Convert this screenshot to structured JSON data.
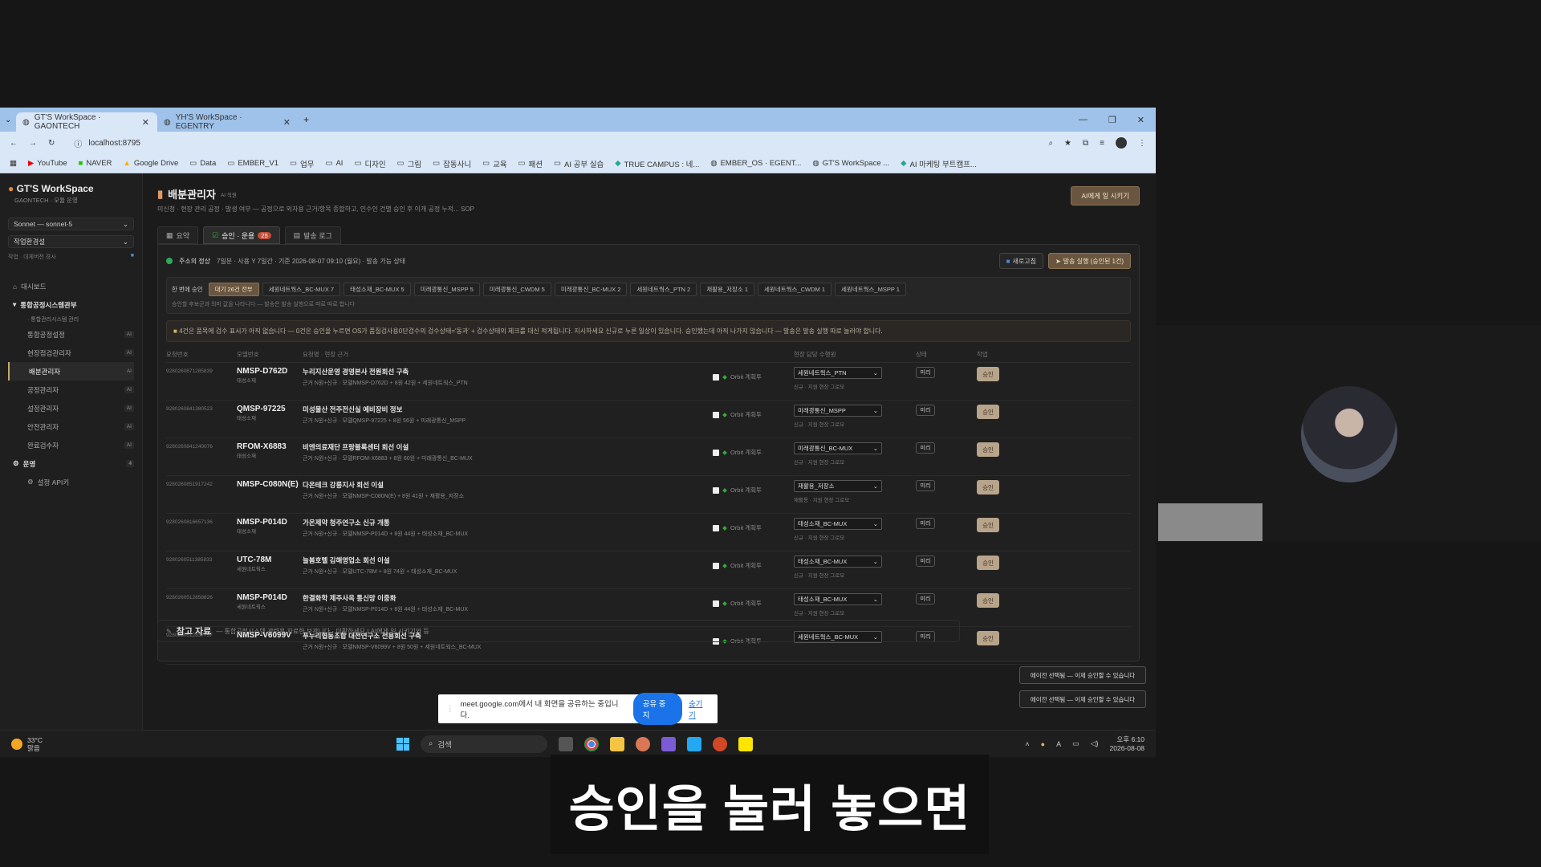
{
  "browser": {
    "tabs": [
      {
        "title": "GT'S WorkSpace · GAONTECH",
        "active": true
      },
      {
        "title": "YH'S WorkSpace · EGENTRY",
        "active": false
      }
    ],
    "url": "localhost:8795",
    "bookmarks": [
      "YouTube",
      "NAVER",
      "Google Drive",
      "Data",
      "EMBER_V1",
      "업무",
      "AI",
      "디자인",
      "그림",
      "잡동사니",
      "교육",
      "패션",
      "AI 공부 실습",
      "TRUE CAMPUS : 네...",
      "EMBER_OS · EGENT...",
      "GT'S WorkSpace ...",
      "AI 마케팅 부트캠프..."
    ]
  },
  "sidebar": {
    "title": "GT'S WorkSpace",
    "subtitle": "GAONTECH · 모듈 운영",
    "model_select": "Sonnet — sonnet-5",
    "profile_select": "작업환경설",
    "note": "작업 · 대체버전 경사",
    "items": [
      {
        "label": "대시보드",
        "badge": "",
        "type": "top"
      },
      {
        "label": "통합공정시스템관부",
        "badge": "",
        "type": "section"
      },
      {
        "label": "· 통합관리시스템 관리",
        "badge": "",
        "type": "sub"
      },
      {
        "label": "통합공정설정",
        "badge": "AI",
        "type": "sub"
      },
      {
        "label": "현장점검관리자",
        "badge": "AI",
        "type": "sub"
      },
      {
        "label": "배분관리자",
        "badge": "AI",
        "type": "sub",
        "active": true
      },
      {
        "label": "공정관리자",
        "badge": "AI",
        "type": "sub"
      },
      {
        "label": "설정관리자",
        "badge": "AI",
        "type": "sub"
      },
      {
        "label": "안전관리자",
        "badge": "AI",
        "type": "sub"
      },
      {
        "label": "완료검수자",
        "badge": "AI",
        "type": "sub"
      },
      {
        "label": "운영",
        "badge": "4",
        "type": "section"
      },
      {
        "label": "설정 API키",
        "badge": "",
        "type": "sub"
      }
    ]
  },
  "page": {
    "title": "배분관리자",
    "title_tag": "AI 직원",
    "desc": "미신청 · 현장 관리 공정 · 발생 여부 — 공정으로 외자용 근거/항목 종합하고, 인수인 건별 승인 후 이개 공정 누적... SOP",
    "top_button": "AI에게 일 시키기",
    "tabs": [
      {
        "label": "요약",
        "count": ""
      },
      {
        "label": "승인 · 운용",
        "count": "25",
        "active": true
      },
      {
        "label": "발송 로그",
        "count": ""
      }
    ]
  },
  "status": {
    "text": "주소의 정상",
    "detail": "7일분 · 사용 Y 7일간 · 기준 2026-08-07 09:10 (월요) · 발송 가능 상태",
    "refresh": "새로고침",
    "run_button": "발송 실행 (승인된 1건)"
  },
  "filters": {
    "label": "한 번에 승인",
    "chips": [
      "대기 26건 전부",
      "세원네트웍스_BC-MUX 7",
      "태성소재_BC-MUX 5",
      "미래광통신_MSPP 5",
      "미래광통신_CWDM 5",
      "미래광통신_BC-MUX 2",
      "세원네트웍스_PTN 2",
      "재활용_저장소 1",
      "세원네트웍스_CWDM 1",
      "세원네트웍스_MSPP 1"
    ],
    "note": "승인할 후보군과 의미 값을 나타니다 — 발송은 발송 실행으로 따로 따로 합니다"
  },
  "notice": "4건은 품목에 검수 표시가 아직 없습니다 — 0건은 승인을 누르면 OS가 품질검사용0단검수의 검수상태='동과' + 검수상태의 체크를 대신 적게됩니다. 지시하세요 신규로 누른 일상이 있습니다. 승인했는데 아직 나가지 않습니다 — 발송은 발송 실행 따로 눌러야 합니다.",
  "table": {
    "headers": [
      "요청번호",
      "모델번호",
      "요청명 · 현장 근거",
      "",
      "현장 담당 수행원",
      "상태",
      "작업"
    ],
    "rows": [
      {
        "id": "9280260871285839",
        "code": "NMSP-D762D",
        "code_sub": "태성소재",
        "title": "누리지산운영 경영본사 전원회선 구축",
        "detail": "근거 N원+신규 · 모델NMSP-D762D + 8원 42원 + 세원네트웍스_PTN",
        "orbit": "Orbit 계획투",
        "select": "세원네트웍스_PTN",
        "select_note": "신규 · 지원 현장 그로모",
        "dd": "미리",
        "action": "승인"
      },
      {
        "id": "9280260841380523",
        "code": "QMSP-97225",
        "code_sub": "태성소재",
        "title": "미성물산 전주전신실 예비장비 정보",
        "detail": "근거 N원+신규 · 모델QMSP-97225 + 8원 56원 + 미래광통신_MSPP",
        "orbit": "Orbit 계획투",
        "select": "미래광통신_MSPP",
        "select_note": "신규 · 지원 현장 그로모",
        "dd": "미리",
        "action": "승인"
      },
      {
        "id": "9280260841240076",
        "code": "RFOM-X6883",
        "code_sub": "태성소재",
        "title": "비엔의료재단 프랑블록센터 회선 이설",
        "detail": "근거 N원+신규 · 모델RFOM-X6883 + 8원 60원 + 미래광통신_BC-MUX",
        "orbit": "Orbit 계획투",
        "select": "미래광통신_BC-MUX",
        "select_note": "신규 · 지원 현장 그로모",
        "dd": "미리",
        "action": "승인"
      },
      {
        "id": "9280260851917242",
        "code": "NMSP-C080N(E)",
        "code_sub": "",
        "title": "다온테크 강릉지사 회선 이설",
        "detail": "근거 N원+신규 · 모델NMSP-C080N(E) + 8원 41원 + 재활용_저장소",
        "orbit": "Orbit 계획투",
        "select": "재활용_저장소",
        "select_note": "재활용 · 지원 현장 그로모",
        "dd": "미리",
        "action": "승인"
      },
      {
        "id": "9280260816657136",
        "code": "NMSP-P014D",
        "code_sub": "태성소재",
        "title": "가온제약 청주연구소 신규 개통",
        "detail": "근거 N원+신규 · 모델NMSP-P014D + 8원 44원 + 태성소재_BC-MUX",
        "orbit": "Orbit 계획투",
        "select": "태성소재_BC-MUX",
        "select_note": "신규 · 지원 현장 그로모",
        "dd": "미리",
        "action": "승인"
      },
      {
        "id": "9280260511385833",
        "code": "UTC-78M",
        "code_sub": "세원네트웍스",
        "title": "늘봄호텔 김해영업소 회선 이설",
        "detail": "근거 N원+신규 · 모델UTC-78M + 8원 74원 + 태성소재_BC-MUX",
        "orbit": "Orbit 계획투",
        "select": "태성소재_BC-MUX",
        "select_note": "신규 · 지원 현장 그로모",
        "dd": "미리",
        "action": "승인"
      },
      {
        "id": "9280260512858826",
        "code": "NMSP-P014D",
        "code_sub": "세원네트웍스",
        "title": "한결화학 제주사옥 통신망 이중화",
        "detail": "근거 N원+신규 · 모델NMSP-P014D + 8원 44원 + 태성소재_BC-MUX",
        "orbit": "Orbit 계획투",
        "select": "태성소재_BC-MUX",
        "select_note": "신규 · 지원 현장 그로모",
        "dd": "미리",
        "action": "승인"
      },
      {
        "id": "9280260512837757",
        "code": "NMSP-V6099V",
        "code_sub": "",
        "title": "푸누리협동조합 대전연구소 전용회선 구축",
        "detail": "근거 N원+신규 · 모델NMSP-V6099V + 8원 50원 + 세원네트웍스_BC-MUX",
        "orbit": "Orbit 계획투",
        "select": "세원네트웍스_BC-MUX",
        "select_note": "",
        "dd": "미리",
        "action": "승인"
      }
    ]
  },
  "reference": {
    "title": "참고 자료",
    "desc": "— 통합공정시스템 관련용 자료한 보관니다 · 미확하세요 | AI에게 일 시키기와 등"
  },
  "toasts": [
    "에이전 선택됨 — 이제 승인할 수 있습니다",
    "에이전 선택됨 — 이제 승인할 수 있습니다"
  ],
  "meet_bar": {
    "text": "meet.google.com에서 내 화면을 공유하는 중입니다.",
    "stop": "공유 중지",
    "hide": "숨기기"
  },
  "taskbar": {
    "temp": "33°C",
    "weather": "맑음",
    "search": "검색",
    "time": "오후 6:10",
    "date": "2026-08-08"
  },
  "subtitle": "승인을 눌러 놓으면"
}
